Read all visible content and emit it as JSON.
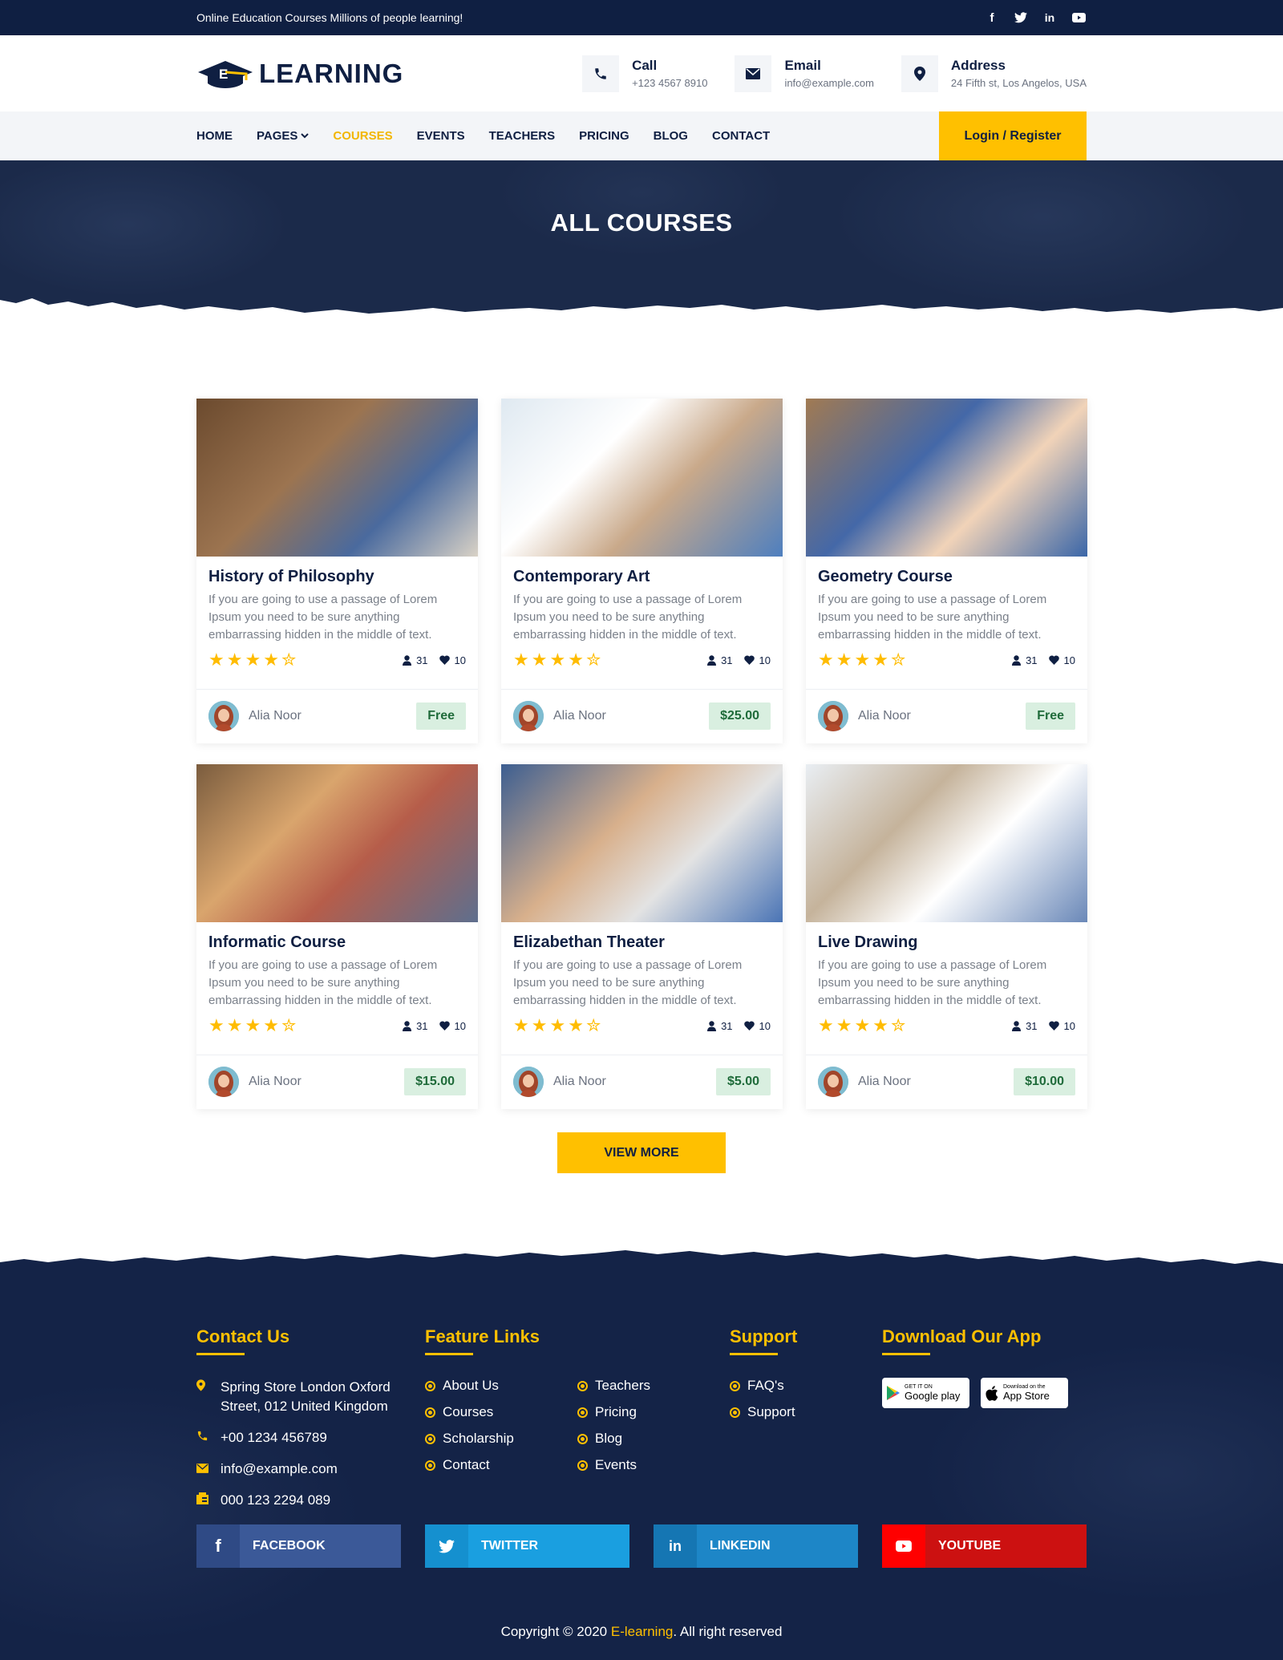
{
  "topbar": {
    "tagline": "Online Education Courses Millions of people learning!",
    "icons": [
      "facebook-icon",
      "twitter-icon",
      "linkedin-icon",
      "youtube-icon"
    ]
  },
  "header": {
    "logo_text": "LEARNING",
    "logo_mark": "E",
    "contacts": [
      {
        "title": "Call",
        "value": "+123 4567 8910",
        "icon": "phone-icon"
      },
      {
        "title": "Email",
        "value": "info@example.com",
        "icon": "envelope-icon"
      },
      {
        "title": "Address",
        "value": "24 Fifth st, Los Angelos, USA",
        "icon": "map-pin-icon"
      }
    ]
  },
  "nav": {
    "items": [
      "HOME",
      "PAGES",
      "COURSES",
      "EVENTS",
      "TEACHERS",
      "PRICING",
      "BLOG",
      "CONTACT"
    ],
    "active": "COURSES",
    "login": "Login / Register"
  },
  "hero": {
    "title": "ALL COURSES"
  },
  "courses": [
    {
      "title": "History of Philosophy",
      "desc": "If you are going to use a passage of Lorem Ipsum you need to be sure anything embarrassing hidden in the middle of text.",
      "students": "31",
      "likes": "10",
      "author": "Alia Noor",
      "price": "Free",
      "rating": 4.5
    },
    {
      "title": "Contemporary Art",
      "desc": "If you are going to use a passage of Lorem Ipsum you need to be sure anything embarrassing hidden in the middle of text.",
      "students": "31",
      "likes": "10",
      "author": "Alia Noor",
      "price": "$25.00",
      "rating": 4.5
    },
    {
      "title": "Geometry Course",
      "desc": "If you are going to use a passage of Lorem Ipsum you need to be sure anything embarrassing hidden in the middle of text.",
      "students": "31",
      "likes": "10",
      "author": "Alia Noor",
      "price": "Free",
      "rating": 4.5
    },
    {
      "title": "Informatic Course",
      "desc": "If you are going to use a passage of Lorem Ipsum you need to be sure anything embarrassing hidden in the middle of text.",
      "students": "31",
      "likes": "10",
      "author": "Alia Noor",
      "price": "$15.00",
      "rating": 4.5
    },
    {
      "title": "Elizabethan Theater",
      "desc": "If you are going to use a passage of Lorem Ipsum you need to be sure anything embarrassing hidden in the middle of text.",
      "students": "31",
      "likes": "10",
      "author": "Alia Noor",
      "price": "$5.00",
      "rating": 4.5
    },
    {
      "title": "Live Drawing",
      "desc": "If you are going to use a passage of Lorem Ipsum you need to be sure anything embarrassing hidden in the middle of text.",
      "students": "31",
      "likes": "10",
      "author": "Alia Noor",
      "price": "$10.00",
      "rating": 4.5
    }
  ],
  "view_more": "VIEW MORE",
  "footer": {
    "contact": {
      "heading": "Contact Us",
      "address": "Spring Store London Oxford Street, 012 United Kingdom",
      "phone": "+00 1234 456789",
      "email": "info@example.com",
      "fax": "000 123 2294 089"
    },
    "features": {
      "heading": "Feature Links",
      "links": [
        "About Us",
        "Teachers",
        "Courses",
        "Pricing",
        "Scholarship",
        "Blog",
        "Contact",
        "Events"
      ]
    },
    "support": {
      "heading": "Support",
      "links": [
        "FAQ's",
        "Support"
      ]
    },
    "app": {
      "heading": "Download Our App",
      "google_small": "GET IT ON",
      "google_big": "Google play",
      "apple_small": "Download on the",
      "apple_big": "App Store"
    },
    "socials": [
      {
        "label": "FACEBOOK",
        "color": "#3b5998",
        "icon_color": "#2f4a85"
      },
      {
        "label": "TWITTER",
        "color": "#1a9fe0",
        "icon_color": "#1590cf"
      },
      {
        "label": "LINKEDIN",
        "color": "#1d86c7",
        "icon_color": "#1576b3"
      },
      {
        "label": "YOUTUBE",
        "color": "#cc1111",
        "icon_color": "#ff0000"
      }
    ],
    "copyright_pre": "Copyright © 2020 ",
    "copyright_brand": "E-learning",
    "copyright_post": ". All right reserved"
  },
  "colors": {
    "navy": "#0f1f42",
    "accent": "#ffc000",
    "price_bg": "#d9efe0"
  }
}
